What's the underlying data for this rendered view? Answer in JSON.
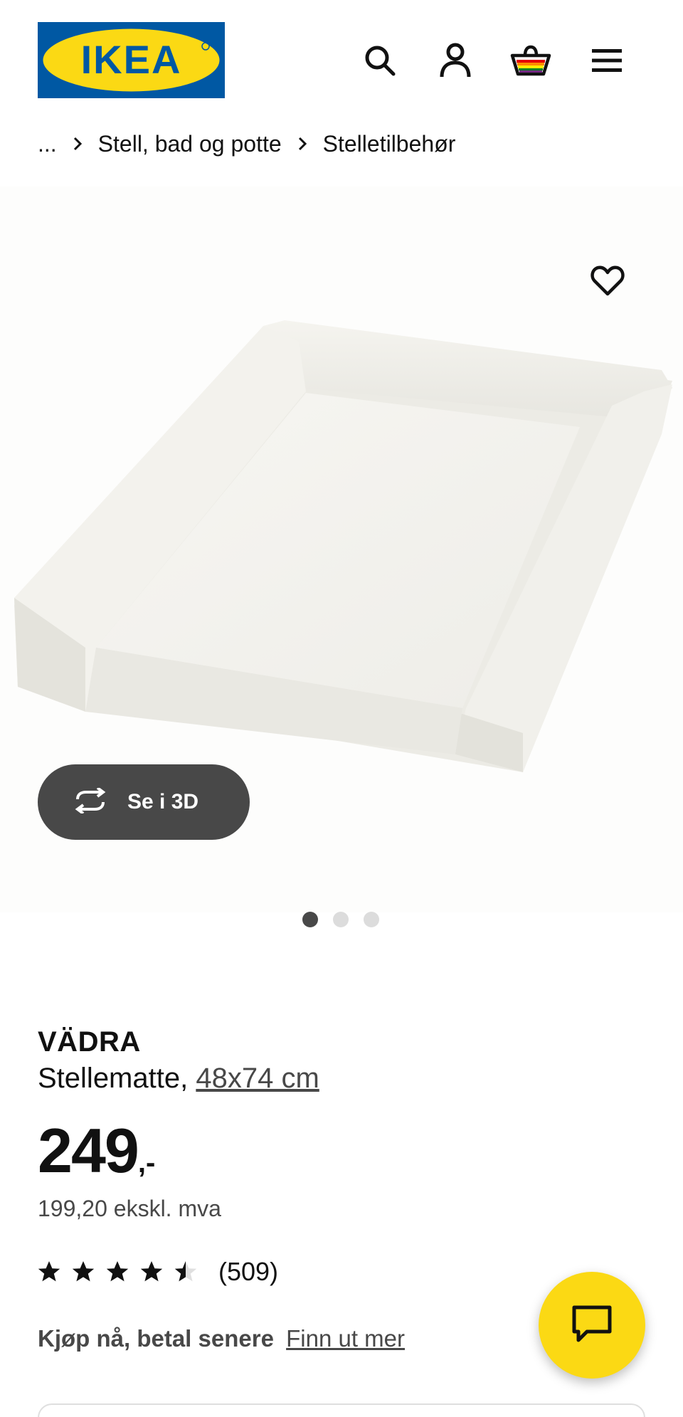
{
  "header": {
    "logo_text": "IKEA",
    "brand_blue": "#0058a3",
    "brand_yellow": "#fbd914",
    "icons": [
      "search-icon",
      "user-icon",
      "cart-icon",
      "menu-icon"
    ]
  },
  "breadcrumb": {
    "ellipsis": "...",
    "items": [
      "Stell, bad og potte",
      "Stelletilbehør"
    ]
  },
  "gallery": {
    "view_3d_label": "Se i 3D",
    "image_count": 3,
    "active_image": 1
  },
  "product": {
    "name": "VÄDRA",
    "type": "Stellematte,",
    "size": "48x74 cm",
    "price_integer": "249",
    "price_decimal": ",-",
    "price_ex_vat": "199,20 ekskl. mva",
    "rating_value": 4.5,
    "rating_count": "(509)"
  },
  "bnpl": {
    "title": "Kjøp nå, betal senere",
    "link": "Finn ut mer"
  }
}
